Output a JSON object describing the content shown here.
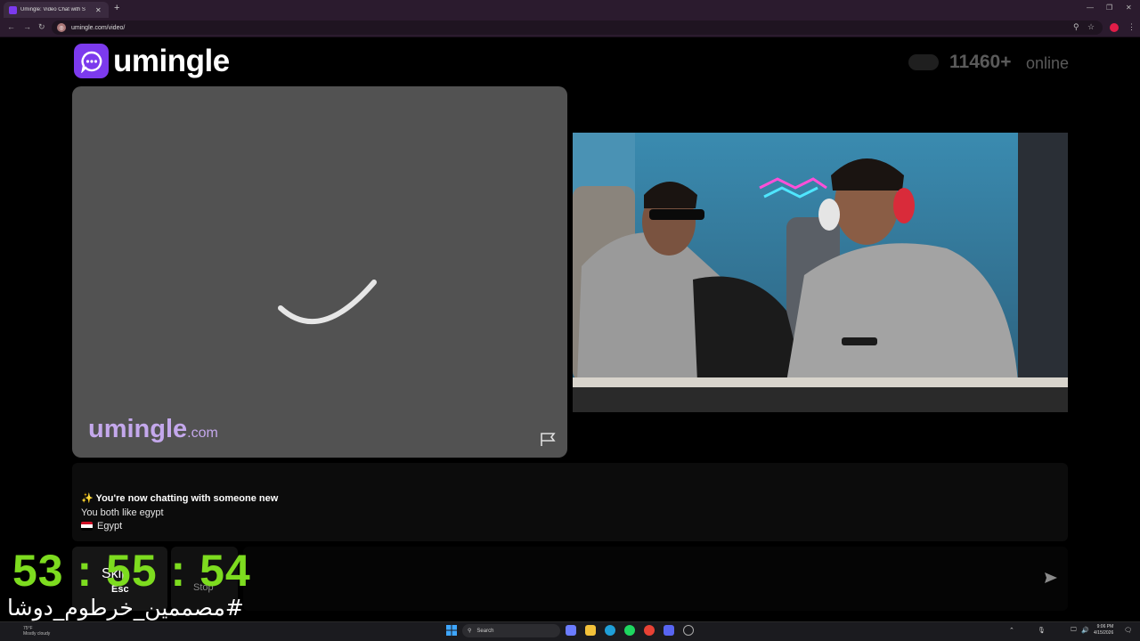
{
  "browser": {
    "tab_title": "Umingle: Video Chat with S",
    "url": "umingle.com/video/"
  },
  "header": {
    "logo_text": "umingle",
    "online_count": "11460+",
    "online_label": "online"
  },
  "stranger_video": {
    "watermark_main": "umingle",
    "watermark_suffix": ".com"
  },
  "chat": {
    "messages": [
      "✨ You're now chatting with someone new",
      "You both like egypt",
      "Egypt"
    ]
  },
  "controls": {
    "skip_label": "Skip",
    "skip_key": "Esc",
    "stop_label": "Stop"
  },
  "overlay": {
    "timer": "53 : 55 : 54",
    "hashtag": "#مصممين_خرطوم_دوشا"
  },
  "taskbar": {
    "weather_temp": "75°F",
    "weather_desc": "Mostly cloudy",
    "search_placeholder": "Search",
    "time": "9:06 PM",
    "date": "4/15/2026"
  }
}
